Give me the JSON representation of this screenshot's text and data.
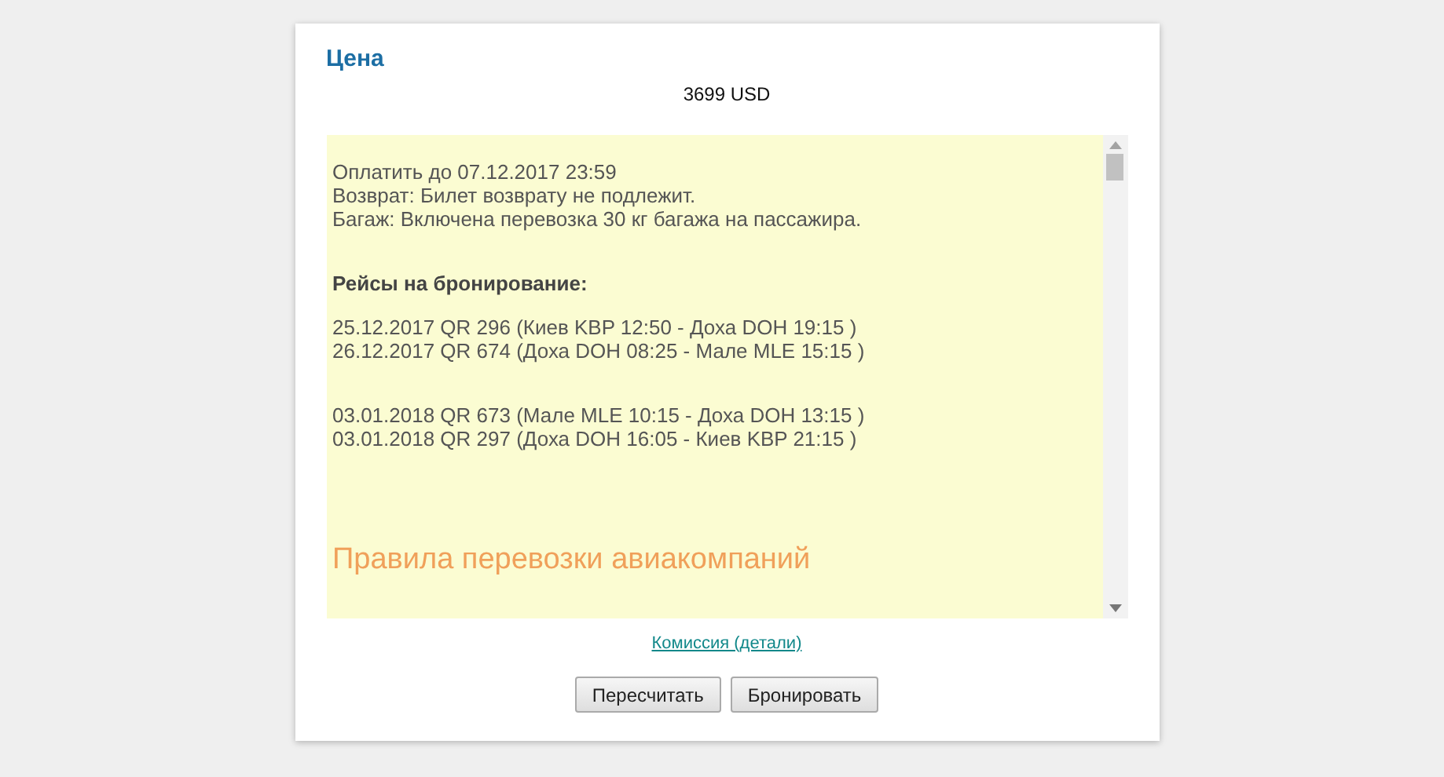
{
  "price": {
    "title": "Цена",
    "amount": "3699 USD"
  },
  "details": {
    "blocks": [
      {
        "kind": "text",
        "lines": [
          "Оплатить до 07.12.2017 23:59",
          "Возврат: Билет возврату не подлежит.",
          "Багаж: Включена перевозка 30 кг багажа на пассажира."
        ]
      },
      {
        "kind": "heading",
        "text": "Рейсы на бронирование:"
      },
      {
        "kind": "text",
        "lines": [
          "25.12.2017 QR 296 (Киев KBP 12:50 - Доха DOH 19:15 )",
          "26.12.2017 QR 674 (Доха DOH 08:25 - Мале MLE 15:15 )"
        ]
      },
      {
        "kind": "text",
        "lines": [
          "03.01.2018 QR 673 (Мале MLE 10:15 - Доха DOH 13:15 )",
          "03.01.2018 QR 297 (Доха DOH 16:05 - Киев KBP 21:15 )"
        ]
      },
      {
        "kind": "title",
        "text": "Правила перевозки авиакомпаний"
      }
    ]
  },
  "commission_link": "Комиссия (детали)",
  "buttons": [
    "Пересчитать",
    "Бронировать"
  ]
}
